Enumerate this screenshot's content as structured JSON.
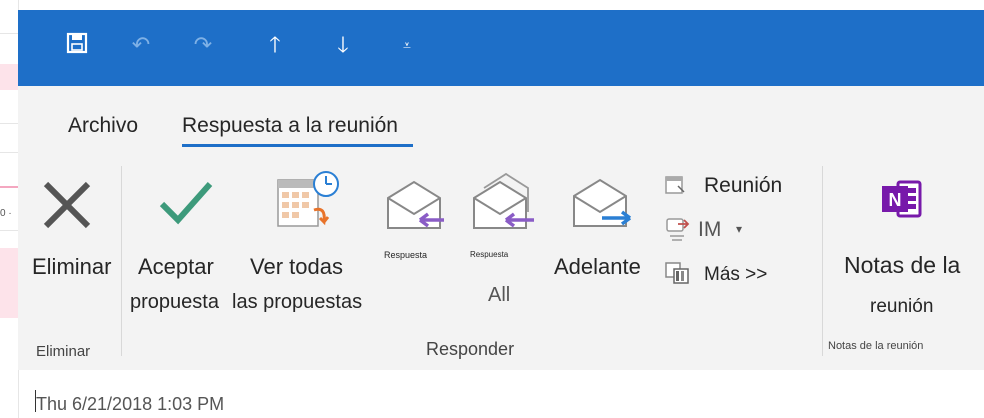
{
  "tabs": [
    "Archivo",
    "Respuesta a la reunión"
  ],
  "ribbon": {
    "eliminar": {
      "label": "Eliminar",
      "group": "Eliminar"
    },
    "aceptar": {
      "line1": "Aceptar",
      "line2": "propuesta"
    },
    "ver_todas": {
      "line1": "Ver todas",
      "line2": "las propuestas"
    },
    "respuesta1": "Respuesta",
    "respuesta2": "Respuesta",
    "all_label": "All",
    "adelante": "Adelante",
    "small_items": [
      "Reunión",
      "IM",
      "Más >>"
    ],
    "responder_group": "Responder",
    "notas": {
      "line1": "Notas de la",
      "line2": "reunión",
      "group": "Notas de la reunión"
    }
  },
  "header": {
    "date": "Thu 6/21/2018 1:03 PM"
  },
  "background": {
    "fragment": "0 ·"
  },
  "colors": {
    "titlebar": "#1e6fc8",
    "ribbon": "#f3f3f3",
    "accept": "#3d9a7b",
    "onenote": "#7719aa",
    "reply_arrow": "#8a5cc6",
    "forward_arrow": "#2a7fd4"
  },
  "icons": [
    "save-icon",
    "undo-icon",
    "redo-icon",
    "up-arrow-icon",
    "down-arrow-icon",
    "customize-qat-icon",
    "delete-x-icon",
    "checkmark-icon",
    "calendar-clock-icon",
    "reply-envelope-icon",
    "reply-all-envelope-icon",
    "forward-envelope-icon",
    "meeting-icon",
    "im-icon",
    "more-icon",
    "onenote-icon"
  ]
}
